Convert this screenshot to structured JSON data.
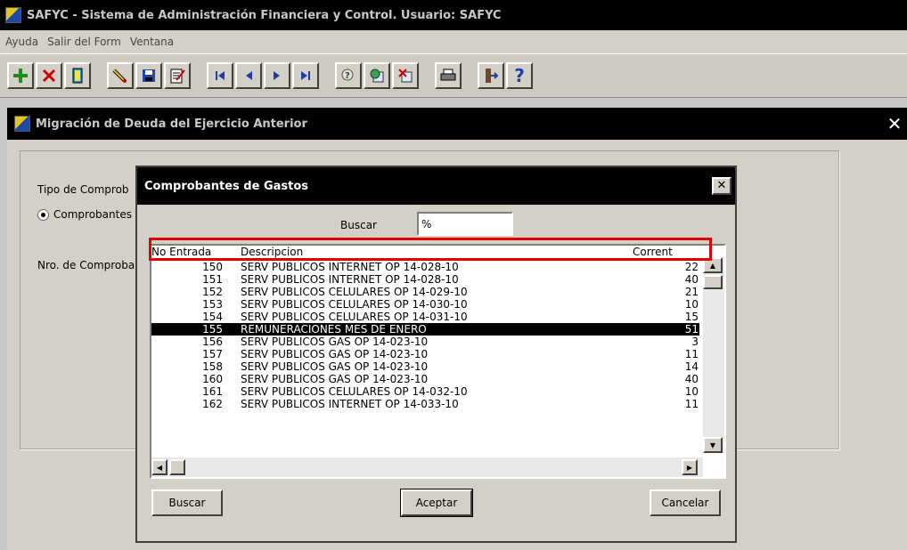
{
  "app": {
    "title": "SAFYC - Sistema de Administración Financiera y Control. Usuario: SAFYC"
  },
  "menu": [
    "Ayuda",
    "Salir del Form",
    "Ventana"
  ],
  "toolbar": {
    "icons": [
      "add-icon",
      "delete-icon",
      "book-icon",
      "edit-pencil-icon",
      "save-icon",
      "checklist-icon",
      "first-record-icon",
      "previous-record-icon",
      "next-record-icon",
      "last-record-icon",
      "query-icon",
      "execute-query-icon",
      "cancel-query-icon",
      "print-icon",
      "exit-icon",
      "help-icon"
    ]
  },
  "inner_window": {
    "title": "Migración de Deuda del Ejercicio Anterior",
    "close": "✕",
    "tipo_label": "Tipo de Comprob",
    "radio_label": "Comprobantes",
    "nro_label": "Nro. de Comproba"
  },
  "dialog": {
    "title": "Comprobantes de Gastos",
    "close": "✕",
    "search_label": "Buscar",
    "search_value": "%",
    "columns": [
      "No Entrada",
      "Descripcion",
      "Corrent"
    ],
    "rows": [
      {
        "no": "150",
        "desc": "SERV PUBLICOS INTERNET OP 14-028-10",
        "cor": "22"
      },
      {
        "no": "151",
        "desc": "SERV PUBLICOS INTERNET OP 14-028-10",
        "cor": "40"
      },
      {
        "no": "152",
        "desc": "SERV PUBLICOS CELULARES OP 14-029-10",
        "cor": "21"
      },
      {
        "no": "153",
        "desc": "SERV PUBLICOS CELULARES OP 14-030-10",
        "cor": "10"
      },
      {
        "no": "154",
        "desc": "SERV PUBLICOS CELULARES OP 14-031-10",
        "cor": "15"
      },
      {
        "no": "155",
        "desc": "REMUNERACIONES MES DE ENERO",
        "cor": "51",
        "selected": true
      },
      {
        "no": "156",
        "desc": "SERV PUBLICOS GAS OP 14-023-10",
        "cor": "3"
      },
      {
        "no": "157",
        "desc": "SERV PUBLICOS GAS OP 14-023-10",
        "cor": "11"
      },
      {
        "no": "158",
        "desc": "SERV PUBLICOS GAS OP 14-023-10",
        "cor": "14"
      },
      {
        "no": "160",
        "desc": "SERV PUBLICOS GAS OP 14-023-10",
        "cor": "40"
      },
      {
        "no": "161",
        "desc": "SERV PUBLICOS CELULARES OP 14-032-10",
        "cor": "10"
      },
      {
        "no": "162",
        "desc": "SERV PUBLICOS INTERNET OP 14-033-10",
        "cor": "11"
      }
    ],
    "buttons": {
      "buscar": "Buscar",
      "aceptar": "Aceptar",
      "cancelar": "Cancelar"
    }
  }
}
